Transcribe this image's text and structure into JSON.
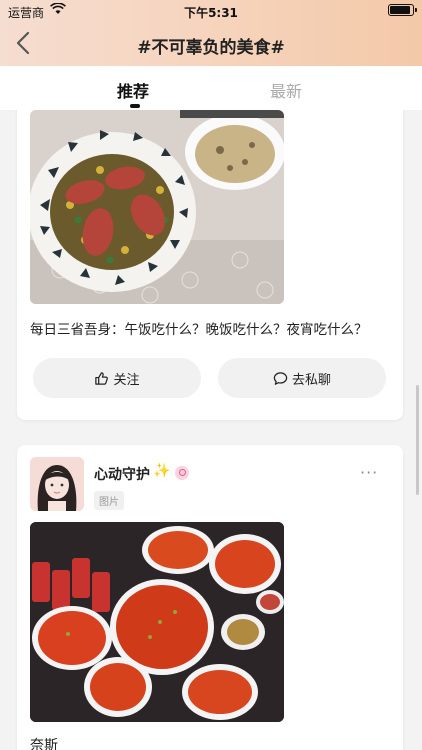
{
  "status_bar": {
    "carrier": "运营商",
    "time": "下午5:31"
  },
  "nav": {
    "title": "#不可辜负的美食#"
  },
  "tabs": [
    {
      "label": "推荐"
    },
    {
      "label": "最新"
    }
  ],
  "posts": [
    {
      "caption": "每日三省吾身：午饭吃什么？晚饭吃什么？夜宵吃什么？",
      "actions": {
        "like_label": "关注",
        "chat_label": "去私聊"
      }
    },
    {
      "user": {
        "name": "心动守护",
        "badge": "✨",
        "tag": "图片"
      },
      "more_label": "···",
      "text": "奈斯"
    }
  ],
  "colors": {
    "header_start": "#f5ddd0",
    "header_end": "#f3c9a8",
    "tab_active": "#111111",
    "tab_inactive": "#aaaaaa"
  }
}
